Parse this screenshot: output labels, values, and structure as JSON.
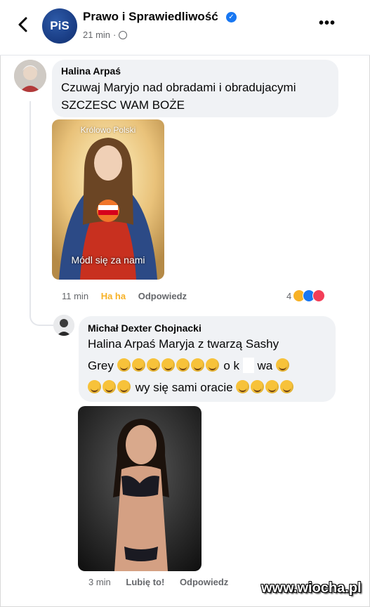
{
  "header": {
    "page_name": "Prawo i Sprawiedliwość",
    "logo_text": "PiS",
    "time": "21 min",
    "dot": "·",
    "more": "•••"
  },
  "comment1": {
    "author": "Halina Arpaś",
    "line1": "Czuwaj Maryjo nad obradami i obradujacymi",
    "line2": "SZCZESC WAM BOŻE",
    "image_caption_top": "Królowo Polski",
    "image_caption_bottom": "Módl się za nami",
    "time": "11 min",
    "reaction_label": "Ha ha",
    "reply_label": "Odpowiedz",
    "reaction_count": "4"
  },
  "comment2": {
    "author": "Michał Dexter Chojnacki",
    "line1": "Halina Arpaś Maryja z twarzą Sashy",
    "line2_start": "Grey",
    "line2_mid": "o k",
    "line2_end": "wa",
    "line3": "wy się sami oracie",
    "time": "3 min",
    "like_label": "Lubię to!",
    "reply_label": "Odpowiedz"
  },
  "watermark": "www.wiocha.pl",
  "colors": {
    "haha": "#f7b125",
    "bubble": "#f0f2f5",
    "verified": "#1877f2",
    "secondary_text": "#65676b"
  },
  "icons": {
    "back": "chevron-left-icon",
    "verified": "verified-badge-icon",
    "globe": "globe-icon",
    "more": "more-icon",
    "emoji": "rofl-emoji-icon"
  }
}
